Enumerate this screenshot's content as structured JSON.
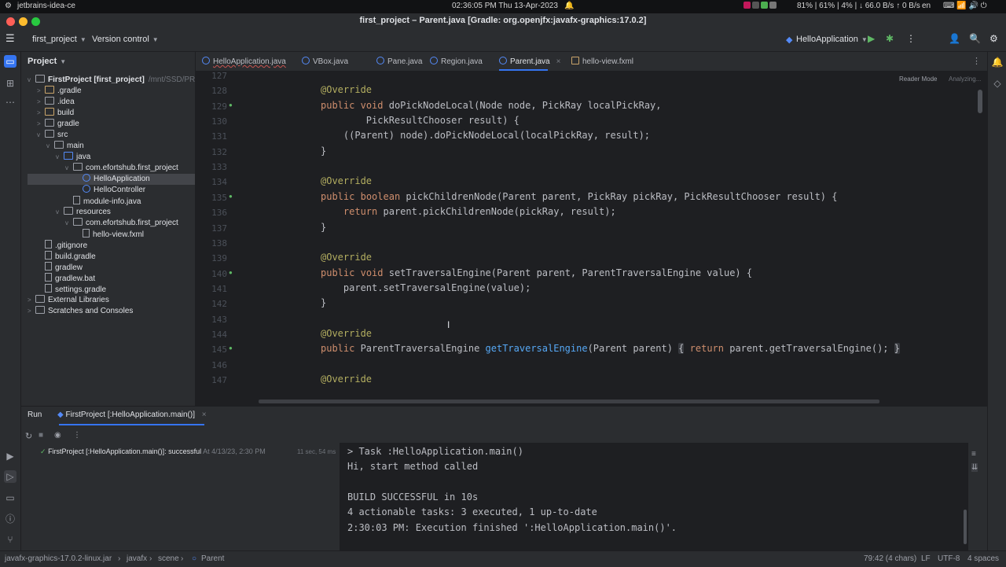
{
  "os": {
    "app": "jetbrains-idea-ce",
    "clock": "02:36:05 PM  Thu  13-Apr-2023",
    "stats": "81% | 61% | 4% | ↓ 66.0 B/s ↑ 0 B/s",
    "lang": "en"
  },
  "window": {
    "title": "first_project – Parent.java [Gradle: org.openjfx:javafx-graphics:17.0.2]"
  },
  "toolbar": {
    "project": "first_project",
    "vcs": "Version control",
    "run_config": "HelloApplication"
  },
  "project_panel": {
    "title": "Project",
    "tree": [
      {
        "label": "FirstProject [first_project]",
        "suffix": "/mnt/SSD/PROJECTS",
        "depth": 0,
        "icon": "folder",
        "open": "v"
      },
      {
        "label": ".gradle",
        "depth": 1,
        "icon": "folder-orange",
        "open": ">"
      },
      {
        "label": ".idea",
        "depth": 1,
        "icon": "folder",
        "open": ">"
      },
      {
        "label": "build",
        "depth": 1,
        "icon": "folder-orange",
        "open": ">"
      },
      {
        "label": "gradle",
        "depth": 1,
        "icon": "folder",
        "open": ">"
      },
      {
        "label": "src",
        "depth": 1,
        "icon": "folder",
        "open": "v"
      },
      {
        "label": "main",
        "depth": 2,
        "icon": "folder",
        "open": "v"
      },
      {
        "label": "java",
        "depth": 3,
        "icon": "folder-blue",
        "open": "v"
      },
      {
        "label": "com.efortshub.first_project",
        "depth": 4,
        "icon": "folder",
        "open": "v"
      },
      {
        "label": "HelloApplication",
        "depth": 5,
        "icon": "class",
        "open": "",
        "selected": true
      },
      {
        "label": "HelloController",
        "depth": 5,
        "icon": "class",
        "open": ""
      },
      {
        "label": "module-info.java",
        "depth": 4,
        "icon": "file",
        "open": ""
      },
      {
        "label": "resources",
        "depth": 3,
        "icon": "folder",
        "open": "v"
      },
      {
        "label": "com.efortshub.first_project",
        "depth": 4,
        "icon": "folder",
        "open": "v"
      },
      {
        "label": "hello-view.fxml",
        "depth": 5,
        "icon": "file",
        "open": ""
      },
      {
        "label": ".gitignore",
        "depth": 1,
        "icon": "file",
        "open": ""
      },
      {
        "label": "build.gradle",
        "depth": 1,
        "icon": "file",
        "open": ""
      },
      {
        "label": "gradlew",
        "depth": 1,
        "icon": "file",
        "open": ""
      },
      {
        "label": "gradlew.bat",
        "depth": 1,
        "icon": "file",
        "open": ""
      },
      {
        "label": "settings.gradle",
        "depth": 1,
        "icon": "file",
        "open": ""
      },
      {
        "label": "External Libraries",
        "depth": 0,
        "icon": "folder",
        "open": ">"
      },
      {
        "label": "Scratches and Consoles",
        "depth": 0,
        "icon": "folder",
        "open": ">"
      }
    ]
  },
  "tabs": [
    "HelloApplication.java",
    "VBox.java",
    "Pane.java",
    "Region.java",
    "Parent.java",
    "hello-view.fxml"
  ],
  "editor": {
    "reader_mode": "Reader Mode",
    "analyzing": "Analyzing...",
    "lines": [
      {
        "n": "127",
        "html": ""
      },
      {
        "n": "128",
        "text": "@Override",
        "cls": "an"
      },
      {
        "n": "129",
        "text": "public void doPickNodeLocal(Node node, PickRay localPickRay,"
      },
      {
        "n": "130",
        "text": "        PickResultChooser result) {"
      },
      {
        "n": "131",
        "text": "    ((Parent) node).doPickNodeLocal(localPickRay, result);"
      },
      {
        "n": "132",
        "text": "}"
      },
      {
        "n": "133",
        "text": ""
      },
      {
        "n": "134",
        "text": "@Override",
        "cls": "an"
      },
      {
        "n": "135",
        "text": "public boolean pickChildrenNode(Parent parent, PickRay pickRay, PickResultChooser result) {"
      },
      {
        "n": "136",
        "text": "    return parent.pickChildrenNode(pickRay, result);"
      },
      {
        "n": "137",
        "text": "}"
      },
      {
        "n": "138",
        "text": ""
      },
      {
        "n": "139",
        "text": "@Override",
        "cls": "an"
      },
      {
        "n": "140",
        "text": "public void setTraversalEngine(Parent parent, ParentTraversalEngine value) {"
      },
      {
        "n": "141",
        "text": "    parent.setTraversalEngine(value);"
      },
      {
        "n": "142",
        "text": "}"
      },
      {
        "n": "143",
        "text": ""
      },
      {
        "n": "144",
        "text": "@Override",
        "cls": "an"
      },
      {
        "n": "145",
        "text": "public ParentTraversalEngine getTraversalEngine(Parent parent) { return parent.getTraversalEngine(); }"
      },
      {
        "n": "146",
        "text": ""
      },
      {
        "n": "147",
        "text": "@Override",
        "cls": "an"
      }
    ]
  },
  "run": {
    "tab_run": "Run",
    "tab_config": "FirstProject [:HelloApplication.main()]",
    "tree_item": "FirstProject [:HelloApplication.main()]: successful",
    "tree_time": "At 4/13/23, 2:30 PM",
    "tree_dur": "11 sec, 54 ms",
    "console": [
      "> Task :HelloApplication.main()",
      "Hi, start method called",
      "",
      "BUILD SUCCESSFUL in 10s",
      "4 actionable tasks: 3 executed, 1 up-to-date",
      "2:30:03 PM: Execution finished ':HelloApplication.main()'."
    ]
  },
  "status": {
    "crumbs": [
      "javafx-graphics-17.0.2-linux.jar",
      "javafx",
      "scene",
      "Parent"
    ],
    "pos": "79:42 (4 chars)",
    "le": "LF",
    "enc": "UTF-8",
    "indent": "4 spaces"
  }
}
